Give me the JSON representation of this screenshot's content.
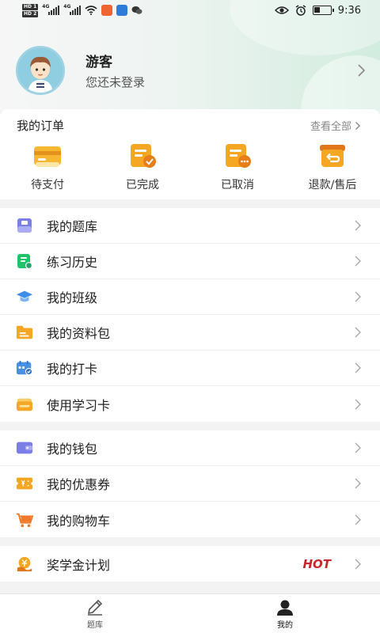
{
  "status_bar": {
    "hd1": "HD 1",
    "hd2": "HD 2",
    "net1": "4G",
    "net2": "4G",
    "time": "9:36"
  },
  "profile": {
    "name": "游客",
    "subtitle": "您还未登录"
  },
  "orders": {
    "title": "我的订单",
    "view_all": "查看全部",
    "items": [
      {
        "label": "待支付",
        "icon": "card-pending-icon"
      },
      {
        "label": "已完成",
        "icon": "check-document-icon"
      },
      {
        "label": "已取消",
        "icon": "cancel-document-icon"
      },
      {
        "label": "退款/售后",
        "icon": "return-box-icon"
      }
    ]
  },
  "menu_groups": [
    [
      {
        "label": "我的题库",
        "icon": "question-bank-icon"
      },
      {
        "label": "练习历史",
        "icon": "history-doc-icon"
      },
      {
        "label": "我的班级",
        "icon": "graduation-cap-icon"
      },
      {
        "label": "我的资料包",
        "icon": "folder-icon"
      },
      {
        "label": "我的打卡",
        "icon": "calendar-check-icon"
      },
      {
        "label": "使用学习卡",
        "icon": "study-card-icon"
      }
    ],
    [
      {
        "label": "我的钱包",
        "icon": "wallet-icon"
      },
      {
        "label": "我的优惠券",
        "icon": "coupon-icon"
      },
      {
        "label": "我的购物车",
        "icon": "shopping-cart-icon"
      }
    ],
    [
      {
        "label": "奖学金计划",
        "icon": "scholarship-icon",
        "badge": "HOT"
      }
    ]
  ],
  "bottom_nav": [
    {
      "label": "题库",
      "icon": "pencil-icon",
      "active": false
    },
    {
      "label": "我的",
      "icon": "person-icon",
      "active": true
    }
  ],
  "colors": {
    "accent_orange": "#f5a623",
    "hot_red": "#c8262b",
    "header_green": "#d2ecdf"
  }
}
